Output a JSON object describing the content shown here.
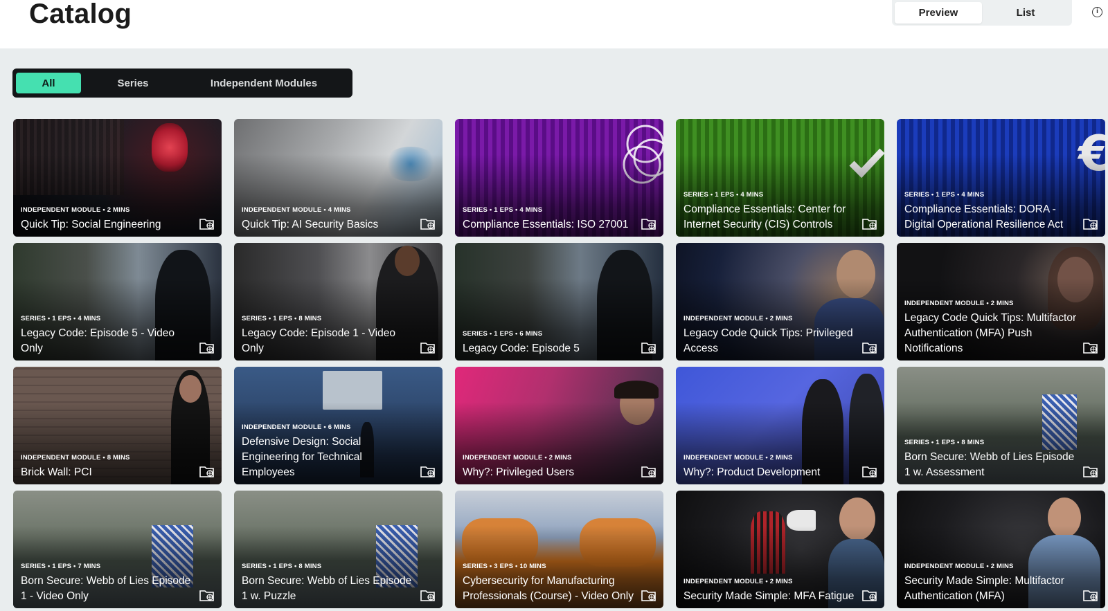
{
  "header": {
    "title": "Catalog",
    "view_toggle": {
      "preview": "Preview",
      "list": "List"
    },
    "info_icon": "i"
  },
  "filters": {
    "all": "All",
    "series": "Series",
    "independent": "Independent Modules"
  },
  "colors": {
    "accent": "#45e0b0",
    "filter_bg": "#141618"
  },
  "cards": [
    {
      "sub": "INDEPENDENT MODULE  • 2 mins",
      "title": "Quick Tip: Social Engineering"
    },
    {
      "sub": "INDEPENDENT MODULE  • 4 mins",
      "title": "Quick Tip: AI Security Basics"
    },
    {
      "sub": "SERIES • 1 EPS  • 4 mins",
      "title": "Compliance Essentials: ISO 27001"
    },
    {
      "sub": "SERIES • 1 EPS  • 4 mins",
      "title": "Compliance Essentials: Center for Internet Security (CIS) Controls"
    },
    {
      "sub": "SERIES • 1 EPS  • 4 mins",
      "title": "Compliance Essentials: DORA - Digital Operational Resilience Act"
    },
    {
      "sub": "SERIES • 1 EPS  • 4 mins",
      "title": "Legacy Code: Episode 5 - Video Only"
    },
    {
      "sub": "SERIES • 1 EPS  • 8 mins",
      "title": "Legacy Code: Episode 1 - Video Only"
    },
    {
      "sub": "SERIES • 1 EPS  • 6 mins",
      "title": "Legacy Code: Episode 5"
    },
    {
      "sub": "INDEPENDENT MODULE  • 2 mins",
      "title": "Legacy Code Quick Tips: Privileged Access"
    },
    {
      "sub": "INDEPENDENT MODULE  • 2 mins",
      "title": "Legacy Code Quick Tips: Multifactor Authentication (MFA) Push Notifications"
    },
    {
      "sub": "INDEPENDENT MODULE  • 8 mins",
      "title": "Brick Wall: PCI"
    },
    {
      "sub": "INDEPENDENT MODULE  • 6 mins",
      "title": "Defensive Design: Social Engineering for Technical Employees"
    },
    {
      "sub": "INDEPENDENT MODULE  • 2 mins",
      "title": "Why?: Privileged Users"
    },
    {
      "sub": "INDEPENDENT MODULE  • 2 mins",
      "title": "Why?: Product Development"
    },
    {
      "sub": "SERIES • 1 EPS  • 8 mins",
      "title": "Born Secure: Webb of Lies Episode 1 w. Assessment"
    },
    {
      "sub": "SERIES • 1 EPS  • 7 mins",
      "title": "Born Secure: Webb of Lies Episode 1 - Video Only"
    },
    {
      "sub": "SERIES • 1 EPS  • 8 mins",
      "title": "Born Secure: Webb of Lies Episode 1 w. Puzzle"
    },
    {
      "sub": "SERIES • 3 EPS  • 10 mins",
      "title": "Cybersecurity for Manufacturing Professionals (Course) - Video Only"
    },
    {
      "sub": "INDEPENDENT MODULE  • 2 mins",
      "title": "Security Made Simple: MFA Fatigue"
    },
    {
      "sub": "INDEPENDENT MODULE  • 2 mins",
      "title": "Security Made Simple: Multifactor Authentication (MFA)"
    }
  ]
}
